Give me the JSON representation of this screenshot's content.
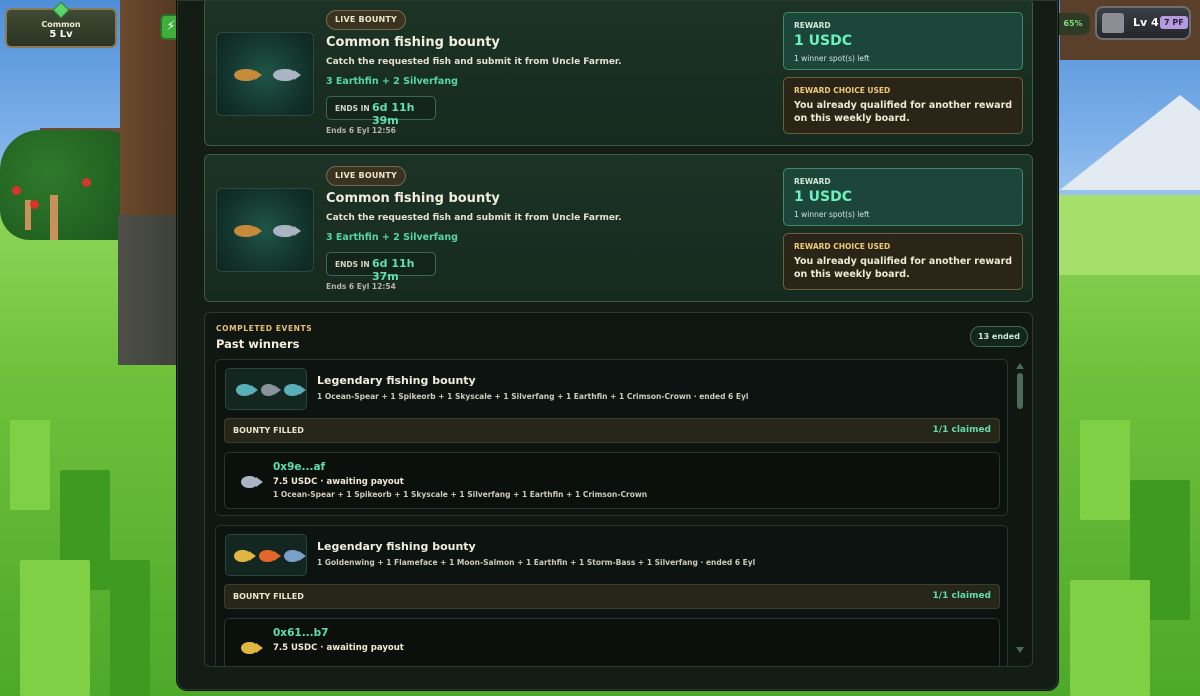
{
  "hud": {
    "rarity_label": "Common",
    "rarity_level": "5 Lv",
    "energy_icon": "⚡",
    "progress_text": "65%",
    "level_label": "Lv 4",
    "pf_label": "7 PF"
  },
  "live_bounties": [
    {
      "badge": "LIVE BOUNTY",
      "title": "Common fishing bounty",
      "description": "Catch the requested fish and submit it from Uncle Farmer.",
      "requirement": "3 Earthfin + 2 Silverfang",
      "ends_label": "ENDS IN",
      "ends_value": "6d 11h 39m",
      "ends_date": "Ends 6 Eyl 12:56",
      "reward_label": "REWARD",
      "reward_amount": "1 USDC",
      "reward_spots": "1 winner spot(s) left",
      "choice_label": "REWARD CHOICE USED",
      "choice_message": "You already qualified for another reward on this weekly board."
    },
    {
      "badge": "LIVE BOUNTY",
      "title": "Common fishing bounty",
      "description": "Catch the requested fish and submit it from Uncle Farmer.",
      "requirement": "3 Earthfin + 2 Silverfang",
      "ends_label": "ENDS IN",
      "ends_value": "6d 11h 37m",
      "ends_date": "Ends 6 Eyl 12:54",
      "reward_label": "REWARD",
      "reward_amount": "1 USDC",
      "reward_spots": "1 winner spot(s) left",
      "choice_label": "REWARD CHOICE USED",
      "choice_message": "You already qualified for another reward on this weekly board."
    }
  ],
  "completed": {
    "kicker": "COMPLETED EVENTS",
    "heading": "Past winners",
    "ended_count": "13 ended",
    "events": [
      {
        "title": "Legendary fishing bounty",
        "requirement": "1 Ocean-Spear + 1 Spikeorb + 1 Skyscale + 1 Silverfang + 1 Earthfin + 1 Crimson-Crown · ended 6 Eyl",
        "status": "BOUNTY FILLED",
        "claimed": "1/1 claimed",
        "winner_address": "0x9e...af",
        "winner_payout": "7.5 USDC · awaiting payout",
        "winner_fish": "1 Ocean-Spear + 1 Spikeorb + 1 Skyscale + 1 Silverfang + 1 Earthfin + 1 Crimson-Crown"
      },
      {
        "title": "Legendary fishing bounty",
        "requirement": "1 Goldenwing + 1 Flameface + 1 Moon-Salmon + 1 Earthfin + 1 Storm-Bass + 1 Silverfang · ended 6 Eyl",
        "status": "BOUNTY FILLED",
        "claimed": "1/1 claimed",
        "winner_address": "0x61...b7",
        "winner_payout": "7.5 USDC · awaiting payout"
      }
    ]
  },
  "colors": {
    "accent_green": "#5fe0b0",
    "gold_label": "#e8c073",
    "panel_bg": "#141c16"
  }
}
